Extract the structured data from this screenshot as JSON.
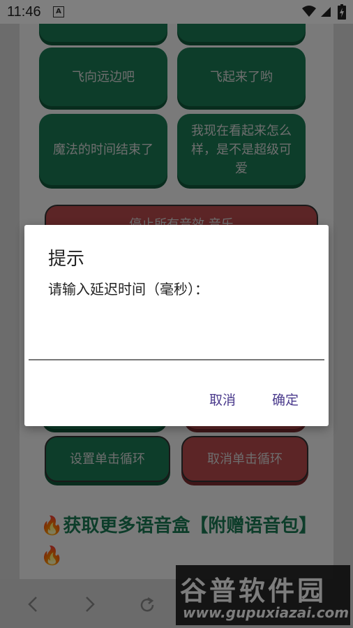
{
  "status_bar": {
    "time": "11:46",
    "icons": [
      "android-notification-icon",
      "wifi-icon",
      "signal-icon",
      "battery-icon"
    ]
  },
  "buttons": {
    "fly_far": "飞向远边吧",
    "fly_up": "飞起来了哟",
    "magic_over": "魔法的时间结束了",
    "how_do_i_look": "我现在看起来怎么样，是不是超级可爱",
    "stop_all": "停止所有音效 音乐",
    "set_click_loop": "设置单击循环",
    "cancel_click_loop": "取消单击循环"
  },
  "promo": {
    "text": "获取更多语音盒【附赠语音包】",
    "icon": "fire-icon"
  },
  "nav": {
    "icons": [
      "back-arrow-icon",
      "forward-arrow-icon",
      "reload-icon"
    ]
  },
  "dialog": {
    "title": "提示",
    "message": "请输入延迟时间（毫秒）：",
    "input_value": "",
    "cancel_label": "取消",
    "ok_label": "确定"
  },
  "watermark": {
    "title": "谷普软件园",
    "url": "www.gupuxiazai.com"
  },
  "colors": {
    "green_button": "#1b7a55",
    "red_button": "#b84a4d",
    "dialog_button_text": "#4a3a8c"
  }
}
